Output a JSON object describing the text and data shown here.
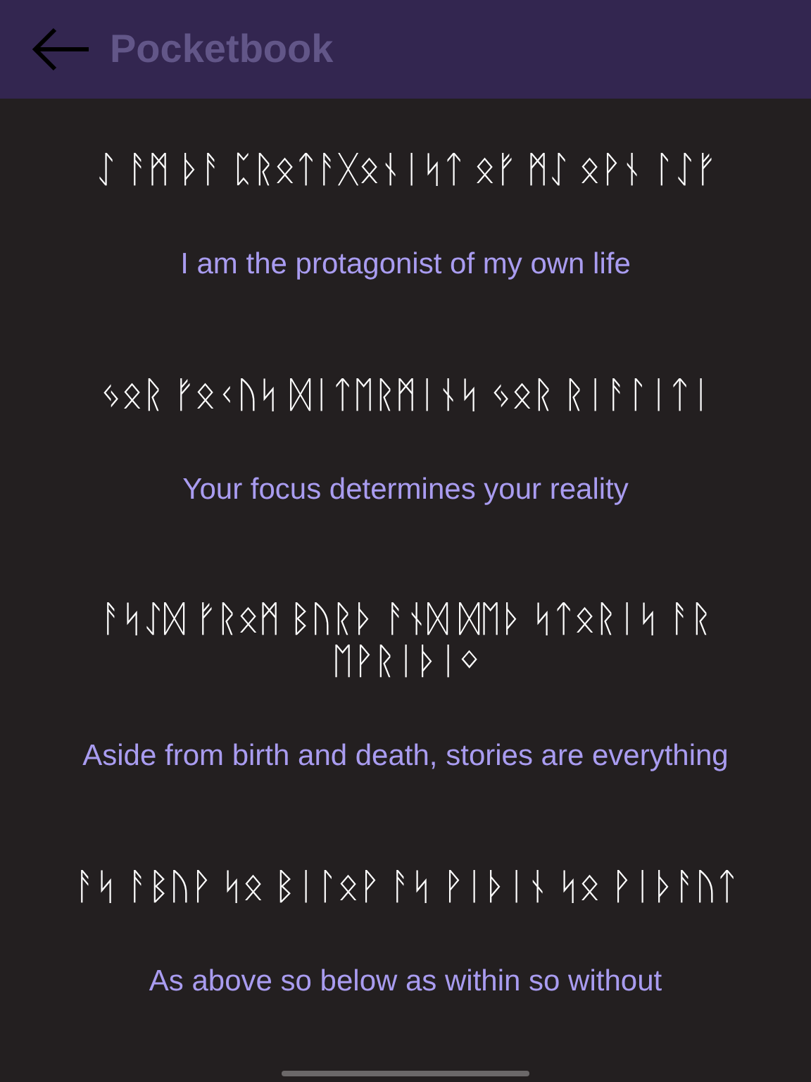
{
  "header": {
    "title": "Pocketbook"
  },
  "quotes": [
    {
      "runes": "ᛇ ᚨᛗ ᚦᚨ ᛈᚱᛟᛏᚨᚷᛟᚾᛁᛋᛏ ᛟᚠ ᛗᛇ ᛟᚹᚾ ᛚᛇᚠ",
      "text": "I am the protagonist of my own life"
    },
    {
      "runes": "ᛃᛟᚱ ᚠᛟᚲᚢᛋ ᛞᛁᛏᛖᚱᛗᛁᚾᛋ ᛃᛟᚱ ᚱᛁᚨᛚᛁᛏᛁ",
      "text": "Your focus determines your reality"
    },
    {
      "runes": "ᚨᛋᛇᛞ ᚠᚱᛟᛗ ᛒᚢᚱᚦ ᚨᚾᛞ ᛞᛖᚦ ᛋᛏᛟᚱᛁᛋ ᚨᚱ ᛖᚹᚱᛁᚦᛁᛜ",
      "text": "Aside from birth and death, stories are everything"
    },
    {
      "runes": "ᚨᛋ ᚨᛒᚢᚹ ᛋᛟ ᛒᛁᛚᛟᚹ ᚨᛋ ᚹᛁᚦᛁᚾ ᛋᛟ ᚹᛁᚦᚨᚢᛏ",
      "text": "As above so below as within so without"
    }
  ]
}
